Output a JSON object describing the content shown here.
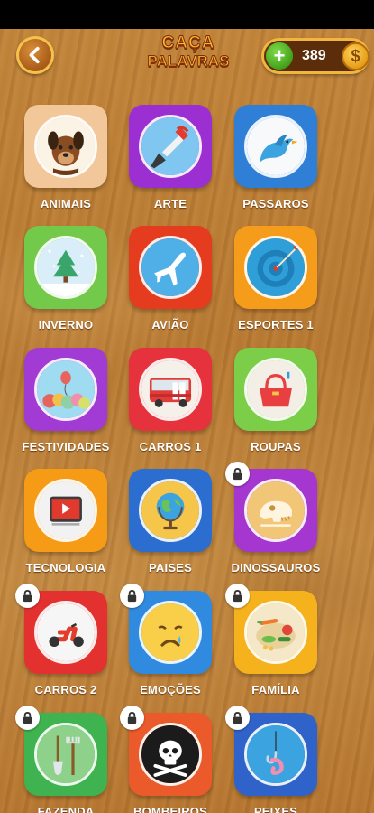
{
  "header": {
    "logo_line1": "CAÇA",
    "logo_line2": "PALAVRAS",
    "coins": "389",
    "plus_label": "+",
    "coin_symbol": "$"
  },
  "categories": [
    {
      "label": "ANIMAIS",
      "icon": "dog-icon",
      "color": "#f2c79a",
      "locked": false
    },
    {
      "label": "ARTE",
      "icon": "paintbrush-icon",
      "color": "#9b2fd1",
      "locked": false
    },
    {
      "label": "PASSAROS",
      "icon": "bird-icon",
      "color": "#2f7fd6",
      "locked": false
    },
    {
      "label": "INVERNO",
      "icon": "pine-tree-icon",
      "color": "#72c94a",
      "locked": false
    },
    {
      "label": "AVIÃO",
      "icon": "airplane-icon",
      "color": "#e53c1f",
      "locked": false
    },
    {
      "label": "ESPORTES 1",
      "icon": "dartboard-icon",
      "color": "#f59d1a",
      "locked": false
    },
    {
      "label": "FESTIVIDADES",
      "icon": "balloons-icon",
      "color": "#a23ad4",
      "locked": false
    },
    {
      "label": "CARROS 1",
      "icon": "bus-icon",
      "color": "#e5323d",
      "locked": false
    },
    {
      "label": "ROUPAS",
      "icon": "handbag-icon",
      "color": "#7ccd47",
      "locked": false
    },
    {
      "label": "TECNOLOGIA",
      "icon": "video-player-icon",
      "color": "#f59b16",
      "locked": false
    },
    {
      "label": "PAISES",
      "icon": "globe-icon",
      "color": "#2b6ecf",
      "locked": false
    },
    {
      "label": "DINOSSAUROS",
      "icon": "dinosaur-skull-icon",
      "color": "#a536cf",
      "locked": true
    },
    {
      "label": "CARROS 2",
      "icon": "scooter-icon",
      "color": "#e3312f",
      "locked": true
    },
    {
      "label": "EMOÇÕES",
      "icon": "sad-face-icon",
      "color": "#2f8ae0",
      "locked": true
    },
    {
      "label": "FAMÍLIA",
      "icon": "vegetables-icon",
      "color": "#f6b21d",
      "locked": true
    },
    {
      "label": "FAZENDA",
      "icon": "shovel-rake-icon",
      "color": "#3fb34f",
      "locked": true
    },
    {
      "label": "BOMBEIROS",
      "icon": "skull-crossbones-icon",
      "color": "#ea5a2a",
      "locked": true
    },
    {
      "label": "PEIXES",
      "icon": "fishing-hook-icon",
      "color": "#2f63c9",
      "locked": true
    }
  ]
}
